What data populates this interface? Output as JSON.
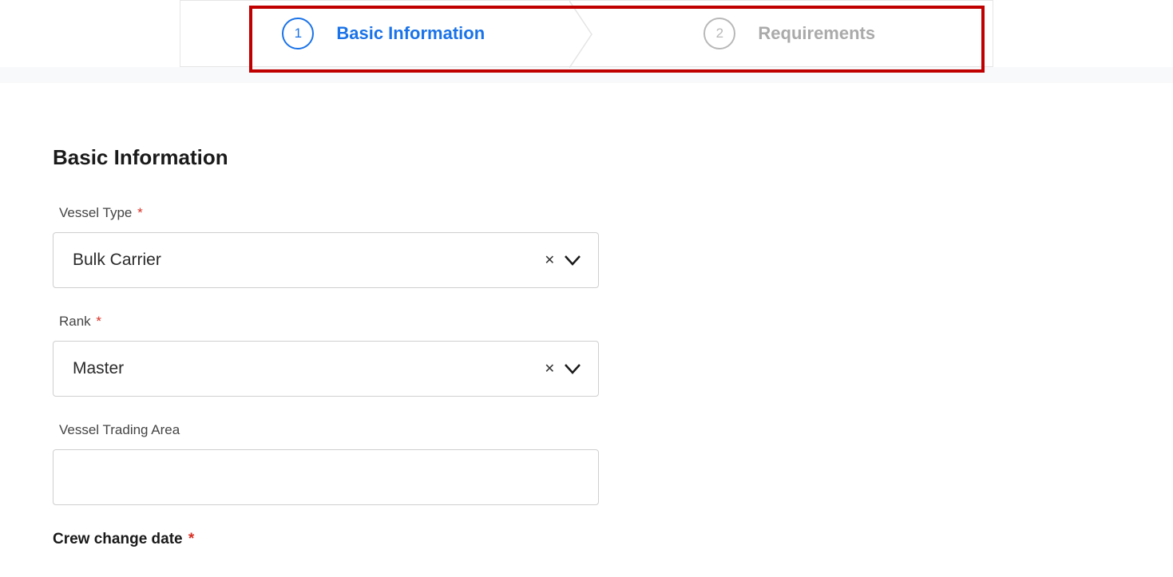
{
  "stepper": {
    "steps": [
      {
        "number": "1",
        "label": "Basic Information",
        "active": true
      },
      {
        "number": "2",
        "label": "Requirements",
        "active": false
      }
    ]
  },
  "section": {
    "title": "Basic Information"
  },
  "fields": {
    "vesselType": {
      "label": "Vessel Type",
      "required": "*",
      "value": "Bulk Carrier"
    },
    "rank": {
      "label": "Rank",
      "required": "*",
      "value": "Master"
    },
    "vesselTradingArea": {
      "label": "Vessel Trading Area",
      "value": ""
    },
    "crewChangeDate": {
      "label": "Crew change date",
      "required": "*"
    }
  }
}
